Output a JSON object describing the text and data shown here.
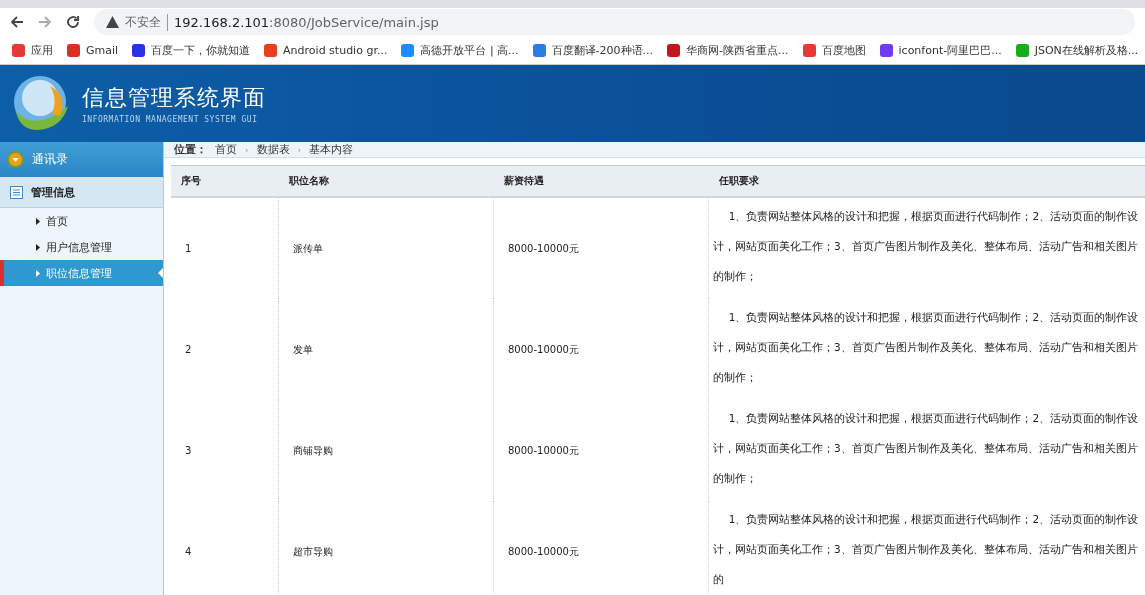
{
  "browser": {
    "security": "不安全",
    "url_host": "192.168.2.101",
    "url_rest": ":8080/JobService/main.jsp",
    "bookmarks": [
      {
        "label": "应用",
        "color": "#e53935"
      },
      {
        "label": "Gmail",
        "color": "#d93025"
      },
      {
        "label": "百度一下，你就知道",
        "color": "#2932e1"
      },
      {
        "label": "Android studio gr...",
        "color": "#e8401c"
      },
      {
        "label": "高德开放平台 | 高...",
        "color": "#1a8cff"
      },
      {
        "label": "百度翻译-200种语...",
        "color": "#2a7de1"
      },
      {
        "label": "华商网-陕西省重点...",
        "color": "#c4161c"
      },
      {
        "label": "百度地图",
        "color": "#e53935"
      },
      {
        "label": "iconfont-阿里巴巴...",
        "color": "#6f3bf5"
      },
      {
        "label": "JSON在线解析及格...",
        "color": "#1aad19"
      }
    ]
  },
  "header": {
    "title": "信息管理系统界面",
    "subtitle": "INFORMATION MANAGEMENT SYSTEM GUI"
  },
  "sidebar": {
    "sections": [
      {
        "label": "通讯录",
        "kind": "top"
      },
      {
        "label": "管理信息",
        "kind": "group"
      }
    ],
    "items": [
      {
        "label": "首页",
        "selected": false
      },
      {
        "label": "用户信息管理",
        "selected": false
      },
      {
        "label": "职位信息管理",
        "selected": true
      }
    ]
  },
  "breadcrumb": {
    "label": "位置：",
    "separator": "›",
    "items": [
      "首页",
      "数据表",
      "基本内容"
    ]
  },
  "table": {
    "columns": [
      "序号",
      "职位名称",
      "薪资待遇",
      "任职要求"
    ],
    "rows": [
      [
        "1",
        "派传单",
        "8000-10000元",
        "1、负责网站整体风格的设计和把握，根据页面进行代码制作；2、活动页面的制作设计，网站页面美化工作；3、首页广告图片制作及美化、整体布局、活动广告和相关图片的制作；"
      ],
      [
        "2",
        "发单",
        "8000-10000元",
        "1、负责网站整体风格的设计和把握，根据页面进行代码制作；2、活动页面的制作设计，网站页面美化工作；3、首页广告图片制作及美化、整体布局、活动广告和相关图片的制作；"
      ],
      [
        "3",
        "商铺导购",
        "8000-10000元",
        "1、负责网站整体风格的设计和把握，根据页面进行代码制作；2、活动页面的制作设计，网站页面美化工作；3、首页广告图片制作及美化、整体布局、活动广告和相关图片的制作；"
      ],
      [
        "4",
        "超市导购",
        "8000-10000元",
        "1、负责网站整体风格的设计和把握，根据页面进行代码制作；2、活动页面的制作设计，网站页面美化工作；3、首页广告图片制作及美化、整体布局、活动广告和相关图片的"
      ]
    ]
  }
}
